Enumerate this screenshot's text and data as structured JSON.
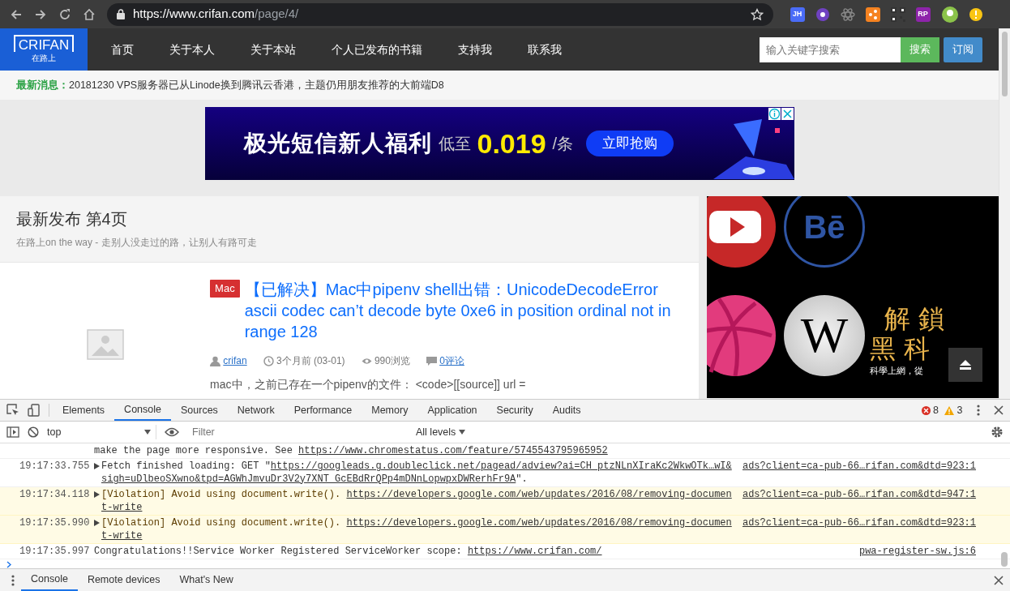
{
  "browser": {
    "url_host": "https://www.crifan.com",
    "url_path": "/page/4/",
    "extensions": [
      {
        "kind": "text",
        "label": "JH",
        "color": "#4a6cf7"
      },
      {
        "kind": "dot",
        "color": "#6f42c1"
      },
      {
        "kind": "atom",
        "color": "#888888"
      },
      {
        "kind": "square",
        "color": "#f58220"
      },
      {
        "kind": "qr",
        "color": "#333333"
      },
      {
        "kind": "text",
        "label": "RP",
        "color": "#8e24aa"
      }
    ]
  },
  "site": {
    "logo": "CRIFAN",
    "logo_sub": "在路上",
    "nav": [
      {
        "label": "首页"
      },
      {
        "label": "关于本人"
      },
      {
        "label": "关于本站"
      },
      {
        "label": "个人已发布的书籍"
      },
      {
        "label": "支持我"
      },
      {
        "label": "联系我"
      }
    ],
    "search": {
      "placeholder": "输入关键字搜索",
      "button": "搜索"
    },
    "subscribe": "订阅"
  },
  "news": {
    "label": "最新消息：",
    "text": "20181230 VPS服务器已从Linode换到腾讯云香港，主题仍用朋友推荐的大前端D8"
  },
  "banner_ad": {
    "headline": "极光短信新人福利",
    "prefix": "低至",
    "price": "0.019",
    "unit": "/条",
    "cta": "立即抢购"
  },
  "page_header": {
    "title": "最新发布 第4页",
    "subtitle": "在路上on the way - 走别人没走过的路，让别人有路可走"
  },
  "post": {
    "tag": "Mac",
    "title": "【已解决】Mac中pipenv shell出错：UnicodeDecodeError ascii codec can’t decode byte 0xe6 in position ordinal not in range 128",
    "author": "crifan",
    "time": "3个月前 (03-01)",
    "views": "990浏览",
    "comments": "0评论",
    "excerpt": "mac中，之前已存在一个pipenv的文件： <code>[[source]] url ="
  },
  "side_ad": {
    "logos": [
      {
        "kind": "play"
      },
      {
        "kind": "ring",
        "text": "Bē"
      },
      {
        "kind": "ball"
      },
      {
        "kind": "disc",
        "text": "W"
      }
    ],
    "line1": "解鎖",
    "line2": "黑科",
    "caption": "科學上網，從"
  },
  "devtools": {
    "tabs": [
      {
        "label": "Elements",
        "selected": false
      },
      {
        "label": "Console",
        "selected": true
      },
      {
        "label": "Sources",
        "selected": false
      },
      {
        "label": "Network",
        "selected": false
      },
      {
        "label": "Performance",
        "selected": false
      },
      {
        "label": "Memory",
        "selected": false
      },
      {
        "label": "Application",
        "selected": false
      },
      {
        "label": "Security",
        "selected": false
      },
      {
        "label": "Audits",
        "selected": false
      }
    ],
    "errors": "8",
    "warnings": "3",
    "context": "top",
    "filter_placeholder": "Filter",
    "levels": "All levels",
    "messages": [
      {
        "kind": "info",
        "expandable": false,
        "text": "make the page more responsive. See ",
        "link": "https://www.chromestatus.com/feature/5745543795965952"
      },
      {
        "kind": "info",
        "expandable": true,
        "time": "19:17:33.755",
        "text": "Fetch finished loading: GET \"",
        "link": "https://googleads.g.doubleclick.net/pagead/adview?ai=CH_ptzNLnXIraKc2WkwOTk…wI&sigh=uDlbeoSXwno&tpd=AGWhJmvuDr3V2y7XNT_GcEBdRrQPp4mDNnLopwpxDWRerhFr9A",
        "tail": "\".",
        "source": "ads?client=ca-pub-66…rifan.com&dtd=923:1"
      },
      {
        "kind": "violation",
        "expandable": true,
        "time": "19:17:34.118",
        "text": "[Violation] Avoid using document.write(). ",
        "link": "https://developers.google.com/web/updates/2016/08/removing-document-write",
        "source": "ads?client=ca-pub-66…rifan.com&dtd=947:1"
      },
      {
        "kind": "violation",
        "expandable": true,
        "time": "19:17:35.990",
        "text": "[Violation] Avoid using document.write(). ",
        "link": "https://developers.google.com/web/updates/2016/08/removing-document-write",
        "source": "ads?client=ca-pub-66…rifan.com&dtd=923:1"
      },
      {
        "kind": "info",
        "expandable": false,
        "time": "19:17:35.997",
        "text": "Congratulations!!Service Worker Registered ServiceWorker scope:  ",
        "link": "https://www.crifan.com/",
        "source": "pwa-register-sw.js:6"
      }
    ],
    "drawer_tabs": [
      {
        "label": "Console",
        "selected": true
      },
      {
        "label": "Remote devices",
        "selected": false
      },
      {
        "label": "What's New",
        "selected": false
      }
    ]
  }
}
